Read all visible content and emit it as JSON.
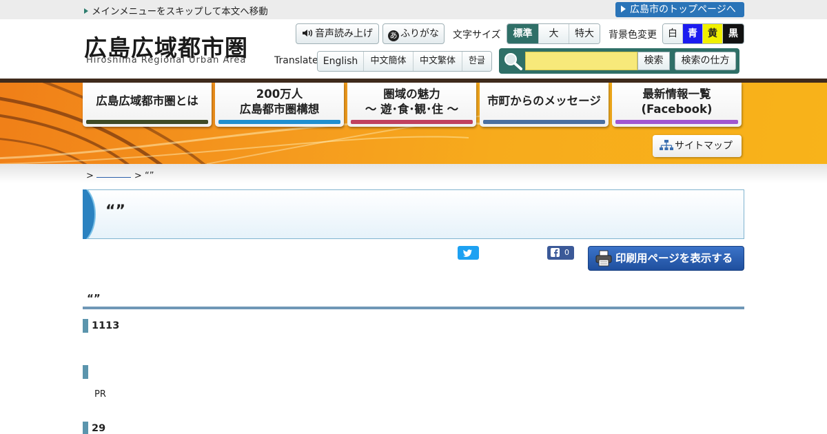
{
  "skip": {
    "label": "メインメニューをスキップして本文へ移動"
  },
  "toplink": {
    "label": "広島市のトップページへ"
  },
  "logo": {
    "title": "広島広域都市圏",
    "subtitle": "Hiroshima Regional Urban Area"
  },
  "tools": {
    "voice": "音声読み上げ",
    "furigana_icon": "あ",
    "furigana": "ふりがな",
    "font_size_label": "文字サイズ",
    "font_sizes": [
      "標準",
      "大",
      "特大"
    ],
    "bg_label": "背景色変更",
    "bg_colors": [
      {
        "label": "白",
        "bg": "#ffffff",
        "fg": "#222222"
      },
      {
        "label": "青",
        "bg": "#1c1cf0",
        "fg": "#ffffff"
      },
      {
        "label": "黄",
        "bg": "#f0f000",
        "fg": "#222222"
      },
      {
        "label": "黒",
        "bg": "#111111",
        "fg": "#ffffff"
      }
    ],
    "translate_label": "Translate",
    "languages": [
      "English",
      "中文簡体",
      "中文繁体",
      "한글"
    ]
  },
  "search": {
    "value": "",
    "button": "検索",
    "how": "検索の仕方"
  },
  "nav": [
    {
      "line1": "広島広域都市圏とは",
      "line2": "",
      "color": "#3e4a26"
    },
    {
      "line1": "200万人",
      "line2": "広島都市圏構想",
      "color": "#1f8fd0"
    },
    {
      "line1": "圏域の魅力",
      "line2": "〜 遊･食･観･住 〜",
      "color": "#c0405f"
    },
    {
      "line1": "市町からのメッセージ",
      "line2": "",
      "color": "#4a6fa0"
    },
    {
      "line1": "最新情報一覧",
      "line2": "(Facebook)",
      "color": "#a056d0"
    }
  ],
  "sitemap": {
    "label": "サイトマップ"
  },
  "breadcrumb": {
    "sep1": ">",
    "sep2": ">",
    "current": "“”"
  },
  "page": {
    "title": "“”"
  },
  "share": {
    "fb_count": "0",
    "print": "印刷用ページを表示する"
  },
  "content": {
    "heading": "“”",
    "sections": [
      {
        "heading": "1113",
        "text": ""
      },
      {
        "heading": "",
        "text": "PR"
      },
      {
        "heading": "29",
        "text": ""
      }
    ]
  },
  "colors": {
    "brand_green": "#2f6f67",
    "accent_blue": "#2a74b8",
    "banner_orange": "#f59a1e"
  }
}
